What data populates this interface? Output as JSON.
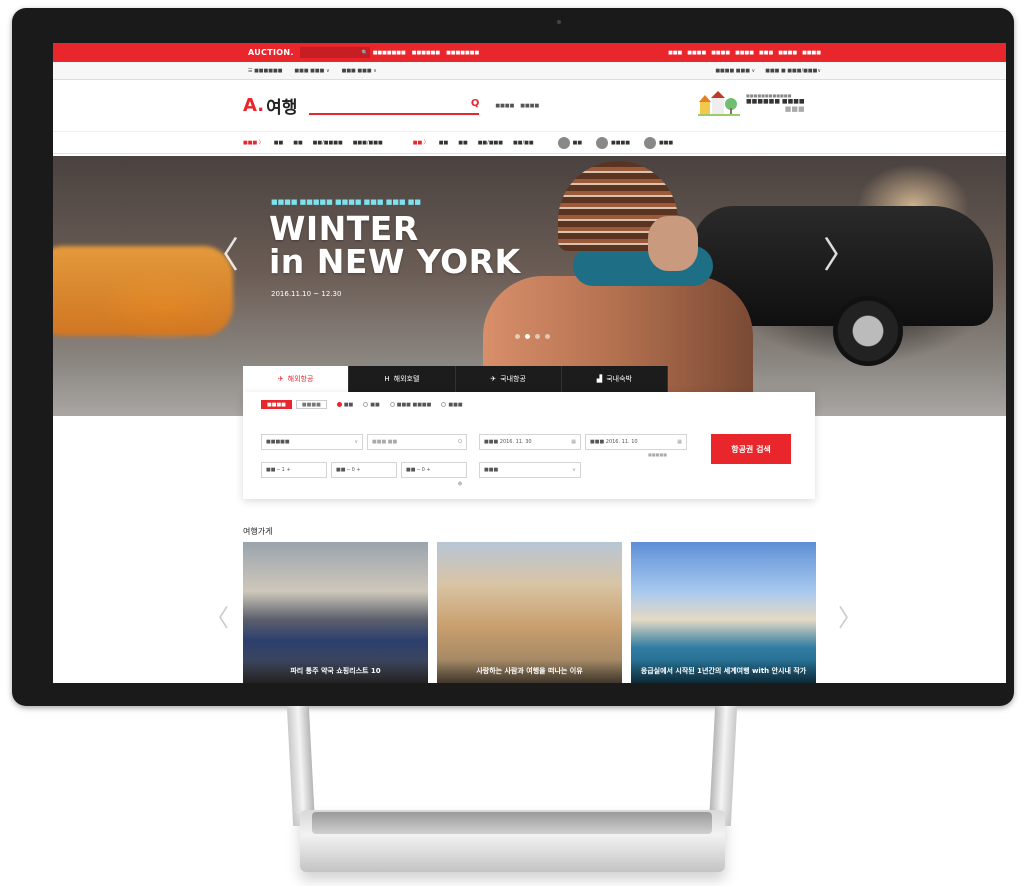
{
  "topbar": {
    "logo": "AUCTION.",
    "links": [
      "■■■■■■■",
      "■■■■■■",
      "■■■■■■■"
    ],
    "right_links": [
      "■■■",
      "■■■■",
      "■■■■",
      "■■■■",
      "■■■",
      "■■■■",
      "■■■■"
    ]
  },
  "subnav": {
    "left": [
      "☰ ■■■■■■",
      "■■■ ■■■ ∨",
      "■■■ ■■■ ∨"
    ],
    "right": [
      "■■■■ ■■■ ∨",
      "■■■ ■ ■■■/■■■∨"
    ]
  },
  "header": {
    "brand_a": "A.",
    "brand_name": "여행",
    "search_icon": "search-icon",
    "links": [
      "■■■■",
      "■■■■"
    ],
    "promo_small": "■■■■■■■■■■■■",
    "promo_text": "■■■■■■ ■■■■",
    "promo_year": "■■■"
  },
  "catnav": {
    "overseas_head": "■■■ 〉",
    "overseas_items": [
      "■■",
      "■■",
      "■■/■■■■",
      "■■■/■■■"
    ],
    "domestic_head": "■■ 〉",
    "domestic_items": [
      "■■",
      "■■",
      "■■/■■■",
      "■■/■■"
    ],
    "circle_items": [
      "■■",
      "■■■■",
      "■■■"
    ]
  },
  "hero": {
    "subtitle": "■■■■ ■■■■■ ■■■■ ■■■ ■■■ ■■",
    "title_line1": "WINTER",
    "title_line2": "in NEW YORK",
    "date": "2016.11.10 ~ 12.30",
    "arrow_left": "〈",
    "arrow_right": "〉",
    "active_slide": 1,
    "slide_count": 4
  },
  "tabs": [
    {
      "icon": "✈",
      "label": "해외항공",
      "active": true
    },
    {
      "icon": "H",
      "label": "해외호텔",
      "active": false
    },
    {
      "icon": "✈",
      "label": "국내항공",
      "active": false
    },
    {
      "icon": "▟",
      "label": "국내숙박",
      "active": false
    }
  ],
  "booking": {
    "trip_pills": [
      "■■■■",
      "■■■■"
    ],
    "radios": [
      "■■",
      "■■",
      "■■■ ■■■■",
      "■■■"
    ],
    "from_value": "■■■■■",
    "to_placeholder": "■■■ ■■",
    "depart_label": "■■■ 2016. 11. 30",
    "return_label": "■■■ 2016. 11. 10",
    "passengers": [
      "■■ ─ 1 +",
      "■■ ─ 0 +",
      "■■ ─ 0 +"
    ],
    "seat_class": "■■■",
    "flex_label": "■■■■■",
    "search_button": "항공권 검색"
  },
  "store": {
    "title": "여행가게",
    "cards": [
      {
        "caption": "파리 통주 약국 쇼핑리스트 10"
      },
      {
        "caption": "사랑하는 사람과 여행을 떠나는 이유"
      },
      {
        "caption": "응급실에서 시작된 1년간의 세계여행 with 안시내 작가"
      }
    ],
    "arrow_left": "〈",
    "arrow_right": "〉"
  },
  "colors": {
    "brand_red": "#e8262b",
    "dark_tab": "#1c1c1c",
    "accent_cyan": "#7fe1ee"
  }
}
